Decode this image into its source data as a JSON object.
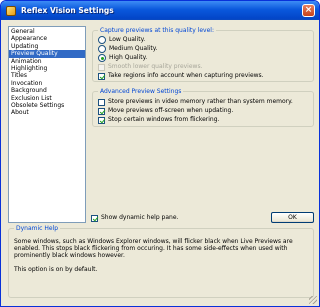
{
  "window": {
    "title": "Reflex Vision Settings",
    "close_glyph": "×"
  },
  "nav": {
    "items": [
      {
        "label": "General",
        "selected": false
      },
      {
        "label": "Appearance",
        "selected": false
      },
      {
        "label": "Updating",
        "selected": false
      },
      {
        "label": "Preview Quality",
        "selected": true
      },
      {
        "label": "Animation",
        "selected": false
      },
      {
        "label": "Highlighting",
        "selected": false
      },
      {
        "label": "Titles",
        "selected": false
      },
      {
        "label": "Invocation",
        "selected": false
      },
      {
        "label": "Background",
        "selected": false
      },
      {
        "label": "Exclusion List",
        "selected": false
      },
      {
        "label": "Obsolete Settings",
        "selected": false
      },
      {
        "label": "About",
        "selected": false
      }
    ]
  },
  "capture": {
    "legend": "Capture previews at this quality level:",
    "options": [
      {
        "label": "Low Quality.",
        "checked": false
      },
      {
        "label": "Medium Quality.",
        "checked": false
      },
      {
        "label": "High Quality.",
        "checked": true
      }
    ],
    "smooth_label": "Smooth lower quality previews.",
    "smooth_checked": false,
    "smooth_disabled": true,
    "regions_label": "Take regions info account when capturing previews.",
    "regions_checked": true
  },
  "advanced": {
    "legend": "Advanced Preview Settings",
    "options": [
      {
        "label": "Store previews in video memory rather than system memory.",
        "checked": false
      },
      {
        "label": "Move previews off-screen when updating.",
        "checked": true
      },
      {
        "label": "Stop certain windows from flickering.",
        "checked": true
      }
    ]
  },
  "dynamic_help_toggle": {
    "label": "Show dynamic help pane.",
    "checked": true
  },
  "ok_label": "OK",
  "help": {
    "legend": "Dynamic Help",
    "paragraph1": "Some windows, such as Windows Explorer windows, will flicker black when Live Previews are enabled. This stops black flickering from occuring. It has some side-effects when used with prominently black windows however.",
    "paragraph2": "This option is on by default."
  },
  "colors": {
    "title_bar": "#0a58dc",
    "window_bg": "#ece9d8",
    "accent_text": "#0046d5",
    "selection": "#316ac5",
    "check_green": "#21a121"
  }
}
